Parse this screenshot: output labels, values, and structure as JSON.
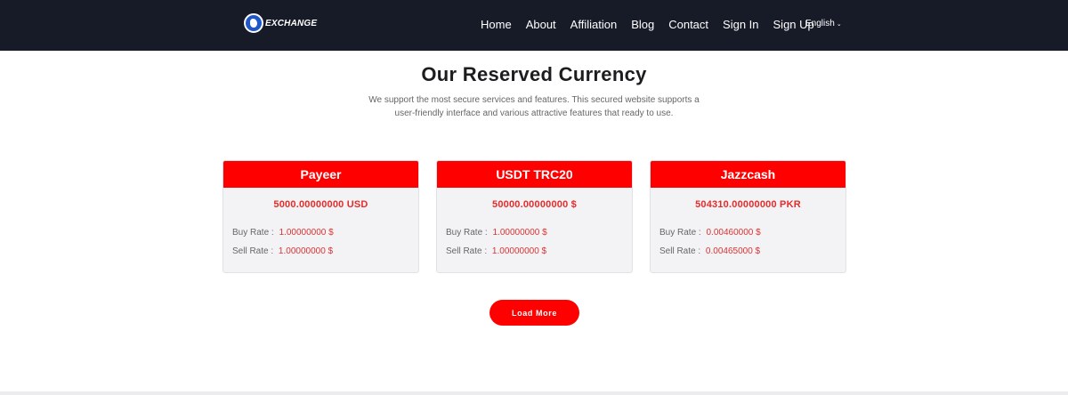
{
  "header": {
    "logo_text": "EXCHANGE",
    "nav": [
      "Home",
      "About",
      "Affiliation",
      "Blog",
      "Contact",
      "Sign In",
      "Sign Up"
    ],
    "language": "English",
    "bg_color": "#171b28"
  },
  "section": {
    "title": "Our Reserved Currency",
    "subtitle_line1": "We support the most secure services and features. This secured website supports a",
    "subtitle_line2": "user-friendly interface and various attractive features that ready to use."
  },
  "cards": [
    {
      "name": "Payeer",
      "reserve": "5000.00000000 USD",
      "buy_label": "Buy Rate :",
      "buy_value": "1.00000000 $",
      "sell_label": "Sell Rate :",
      "sell_value": "1.00000000 $"
    },
    {
      "name": "USDT TRC20",
      "reserve": "50000.00000000 $",
      "buy_label": "Buy Rate :",
      "buy_value": "1.00000000 $",
      "sell_label": "Sell Rate :",
      "sell_value": "1.00000000 $"
    },
    {
      "name": "Jazzcash",
      "reserve": "504310.00000000 PKR",
      "buy_label": "Buy Rate :",
      "buy_value": "0.00460000 $",
      "sell_label": "Sell Rate :",
      "sell_value": "0.00465000 $"
    }
  ],
  "load_more_label": "Load More",
  "colors": {
    "accent": "#ff0000",
    "card_bg": "#f3f3f5"
  }
}
